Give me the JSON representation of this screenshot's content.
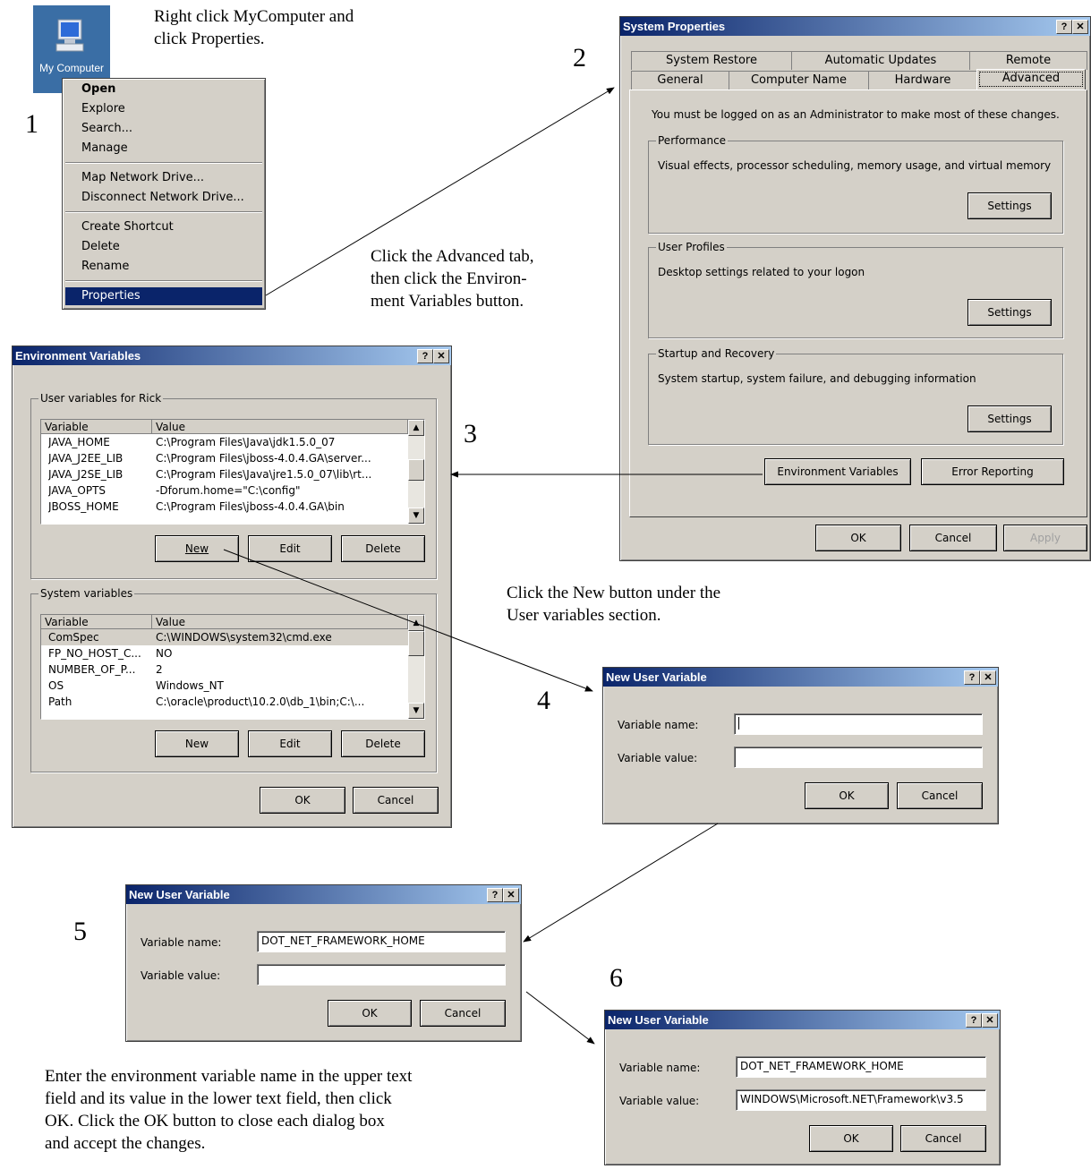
{
  "steps": {
    "s1": "1",
    "s2": "2",
    "s3": "3",
    "s4": "4",
    "s5": "5",
    "s6": "6"
  },
  "notes": {
    "n1_line1": "Right click MyComputer and",
    "n1_line2": "click Properties.",
    "n2_line1": "Click the Advanced tab,",
    "n2_line2": "then click the Environ-",
    "n2_line3": "ment Variables button.",
    "n3_line1": "Click the New button under the",
    "n3_line2": "User variables section.",
    "n4_line1": "Enter the environment variable name in the upper text",
    "n4_line2": "field and its value in the lower text field, then click",
    "n4_line3": "OK. Click the OK button to close each dialog box",
    "n4_line4": "and accept the changes."
  },
  "desktop": {
    "icon_label": "My Computer",
    "icon": "my-computer-icon"
  },
  "context_menu": {
    "items": [
      "Open",
      "Explore",
      "Search...",
      "Manage",
      "Map Network Drive...",
      "Disconnect Network Drive...",
      "Create Shortcut",
      "Delete",
      "Rename",
      "Properties"
    ],
    "selected": "Properties"
  },
  "sysprops": {
    "title": "System Properties",
    "help": "?",
    "close": "✕",
    "tabs_back": [
      "System Restore",
      "Automatic Updates",
      "Remote"
    ],
    "tabs_front": [
      "General",
      "Computer Name",
      "Hardware",
      "Advanced"
    ],
    "admin_note": "You must be logged on as an Administrator to make most of these changes.",
    "perf_label": "Performance",
    "perf_desc": "Visual effects, processor scheduling, memory usage, and virtual memory",
    "profiles_label": "User Profiles",
    "profiles_desc": "Desktop settings related to your logon",
    "startup_label": "Startup and Recovery",
    "startup_desc": "System startup, system failure, and debugging information",
    "settings": "Settings",
    "env_button": "Environment Variables",
    "error_button": "Error Reporting",
    "ok": "OK",
    "cancel": "Cancel",
    "apply": "Apply"
  },
  "envvars": {
    "title": "Environment Variables",
    "help": "?",
    "close": "✕",
    "user_group": "User variables for Rick",
    "system_group": "System variables",
    "col_variable": "Variable",
    "col_value": "Value",
    "user_rows": [
      {
        "var": "JAVA_HOME",
        "val": "C:\\Program Files\\Java\\jdk1.5.0_07"
      },
      {
        "var": "JAVA_J2EE_LIB",
        "val": "C:\\Program Files\\jboss-4.0.4.GA\\server..."
      },
      {
        "var": "JAVA_J2SE_LIB",
        "val": "C:\\Program Files\\Java\\jre1.5.0_07\\lib\\rt..."
      },
      {
        "var": "JAVA_OPTS",
        "val": "-Dforum.home=\"C:\\config\""
      },
      {
        "var": "JBOSS_HOME",
        "val": "C:\\Program Files\\jboss-4.0.4.GA\\bin"
      }
    ],
    "system_rows": [
      {
        "var": "ComSpec",
        "val": "C:\\WINDOWS\\system32\\cmd.exe"
      },
      {
        "var": "FP_NO_HOST_C...",
        "val": "NO"
      },
      {
        "var": "NUMBER_OF_P...",
        "val": "2"
      },
      {
        "var": "OS",
        "val": "Windows_NT"
      },
      {
        "var": "Path",
        "val": "C:\\oracle\\product\\10.2.0\\db_1\\bin;C:\\..."
      }
    ],
    "new": "New",
    "edit": "Edit",
    "delete": "Delete",
    "ok": "OK",
    "cancel": "Cancel"
  },
  "newvar1": {
    "title": "New User Variable",
    "help": "?",
    "close": "✕",
    "name_label": "Variable name:",
    "value_label": "Variable value:",
    "name_value": "",
    "value_value": "",
    "ok": "OK",
    "cancel": "Cancel"
  },
  "newvar2": {
    "title": "New User Variable",
    "help": "?",
    "close": "✕",
    "name_label": "Variable name:",
    "value_label": "Variable value:",
    "name_value": "DOT_NET_FRAMEWORK_HOME",
    "value_value": "",
    "ok": "OK",
    "cancel": "Cancel"
  },
  "newvar3": {
    "title": "New User Variable",
    "help": "?",
    "close": "✕",
    "name_label": "Variable name:",
    "value_label": "Variable value:",
    "name_value": "DOT_NET_FRAMEWORK_HOME",
    "value_value": "WINDOWS\\Microsoft.NET\\Framework\\v3.5",
    "ok": "OK",
    "cancel": "Cancel"
  },
  "colors": {
    "titlebar_start": "#0a246a",
    "titlebar_end": "#a6caf0",
    "dialog_bg": "#d4d0c8",
    "desktop_blue": "#3a6ea5"
  }
}
